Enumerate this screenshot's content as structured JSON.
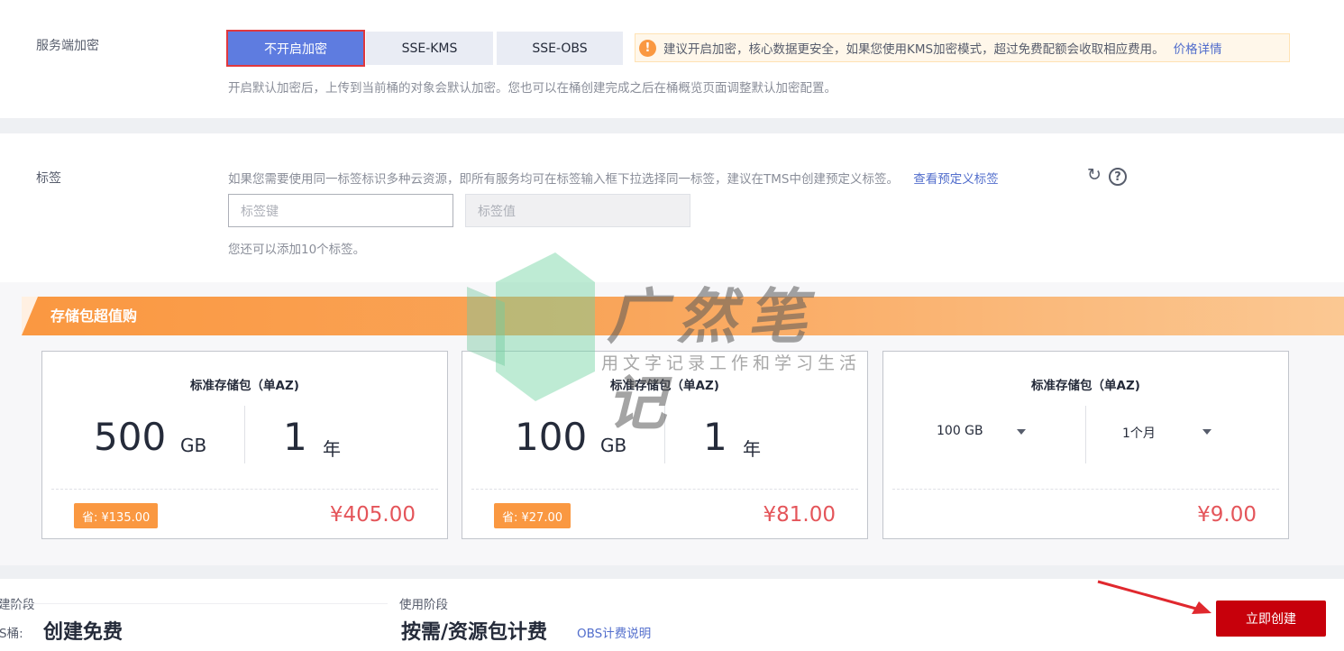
{
  "encryption": {
    "label": "服务端加密",
    "options": [
      "不开启加密",
      "SSE-KMS",
      "SSE-OBS"
    ],
    "notice": "建议开启加密，核心数据更安全，如果您使用KMS加密模式，超过免费配额会收取相应费用。",
    "notice_link": "价格详情",
    "hint": "开启默认加密后，上传到当前桶的对象会默认加密。您也可以在桶创建完成之后在桶概览页面调整默认加密配置。"
  },
  "tags": {
    "label": "标签",
    "desc": "如果您需要使用同一标签标识多种云资源，即所有服务均可在标签输入框下拉选择同一标签，建议在TMS中创建预定义标签。",
    "desc_link": "查看预定义标签",
    "key_placeholder": "标签键",
    "value_placeholder": "标签值",
    "hint": "您还可以添加10个标签。"
  },
  "promo": {
    "title": "存储包超值购",
    "cards": [
      {
        "title": "标准存储包（单AZ)",
        "size": "500",
        "size_unit": "GB",
        "term": "1",
        "term_unit": "年",
        "save": "省: ¥135.00",
        "price": "¥405.00"
      },
      {
        "title": "标准存储包（单AZ)",
        "size": "100",
        "size_unit": "GB",
        "term": "1",
        "term_unit": "年",
        "save": "省: ¥27.00",
        "price": "¥81.00"
      },
      {
        "title": "标准存储包（单AZ)",
        "size_select": "100 GB",
        "term_select": "1个月",
        "price": "¥9.00"
      }
    ]
  },
  "watermark": {
    "title": "广然笔记",
    "subtitle": "用文字记录工作和学习生活"
  },
  "footer": {
    "create_stage_label": "建阶段",
    "create_stage_prefix": "S桶:",
    "create_stage_value": "创建免费",
    "use_stage_label": "使用阶段",
    "use_stage_value": "按需/资源包计费",
    "billing_link": "OBS计费说明",
    "create_button": "立即创建"
  },
  "colors": {
    "accent": "#5e7ce0",
    "primary_button": "#c7000b",
    "promo": "#fa9841",
    "price": "#e0383e"
  }
}
